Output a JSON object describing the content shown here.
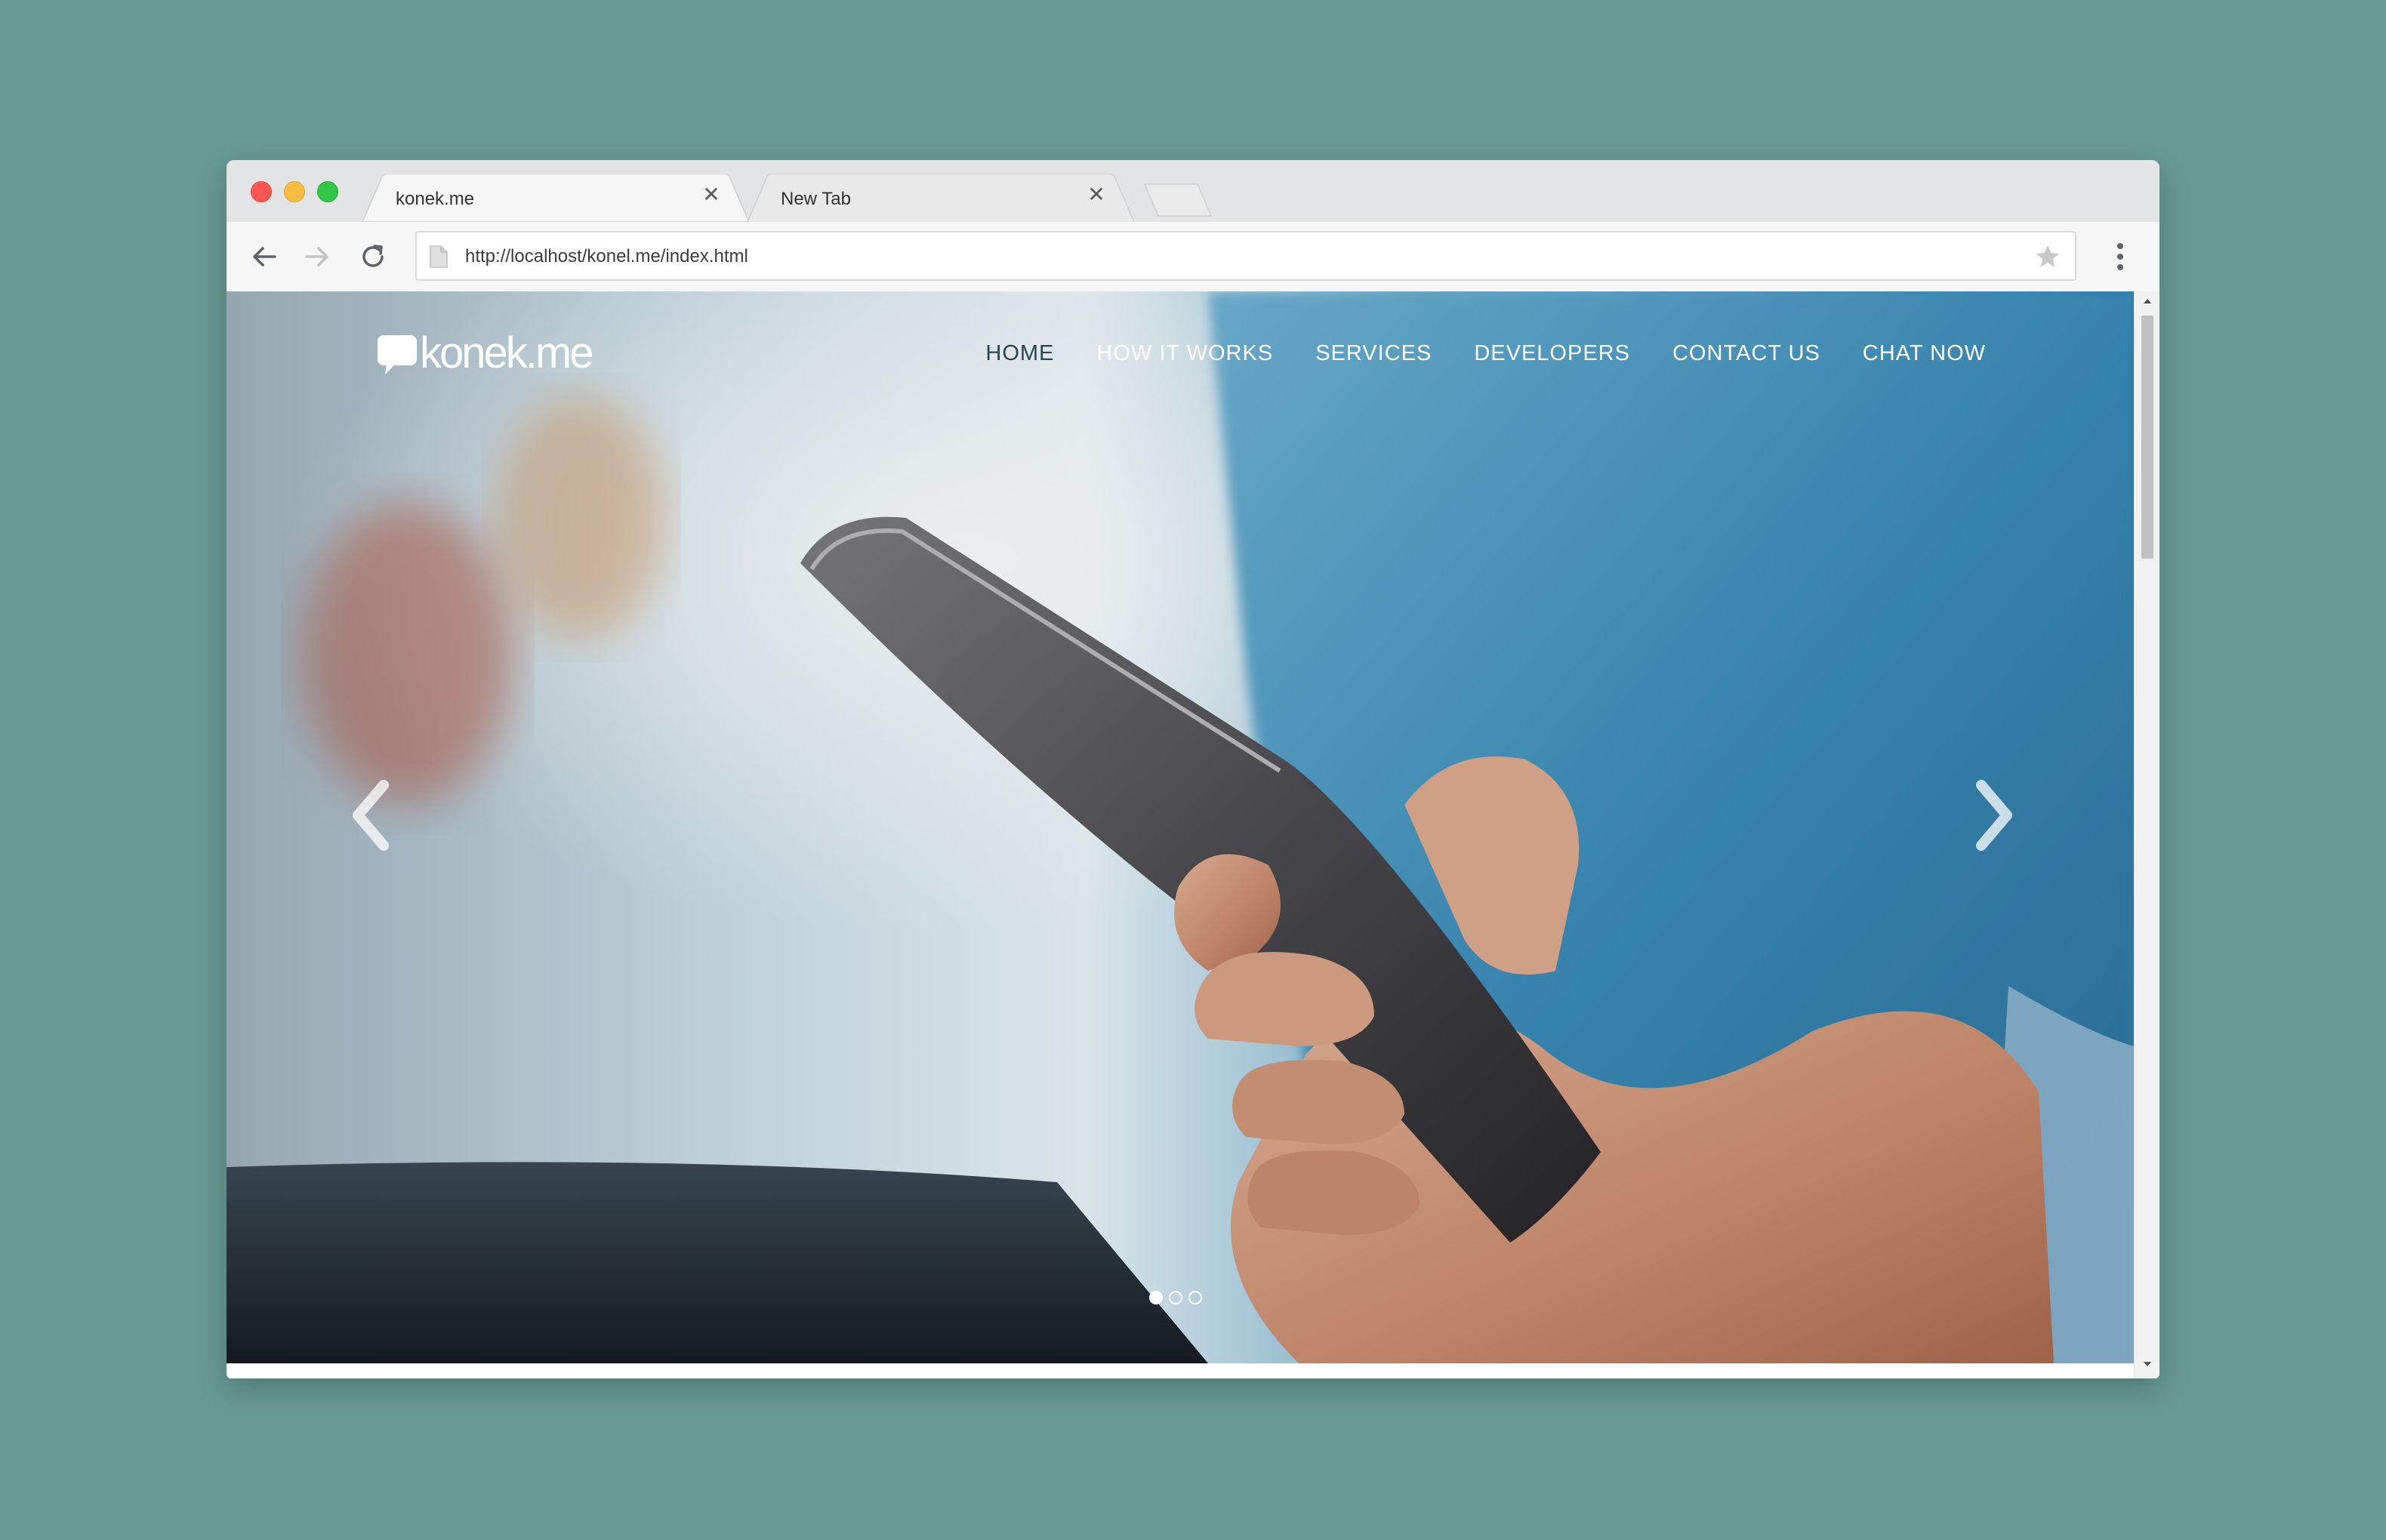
{
  "window": {
    "tabs": [
      {
        "title": "konek.me",
        "active": true
      },
      {
        "title": "New Tab",
        "active": false
      }
    ],
    "close_glyph": "✕"
  },
  "toolbar": {
    "url": "http://localhost/konel.me/index.html",
    "icons": [
      "back-arrow-icon",
      "forward-arrow-icon",
      "reload-icon",
      "page-icon",
      "star-icon",
      "kebab-menu-icon"
    ]
  },
  "site": {
    "logo": "konek.me",
    "nav": [
      {
        "label": "HOME",
        "active": true
      },
      {
        "label": "HOW IT WORKS",
        "active": false
      },
      {
        "label": "SERVICES",
        "active": false
      },
      {
        "label": "DEVELOPERS",
        "active": false
      },
      {
        "label": "CONTACT US",
        "active": false
      },
      {
        "label": "CHAT NOW",
        "active": false
      }
    ],
    "carousel": {
      "slide_count": 3,
      "active_index": 0
    }
  },
  "colors": {
    "desktop": "#669a93",
    "nav_active": "#2a4450",
    "nav_text": "#ffffff"
  }
}
